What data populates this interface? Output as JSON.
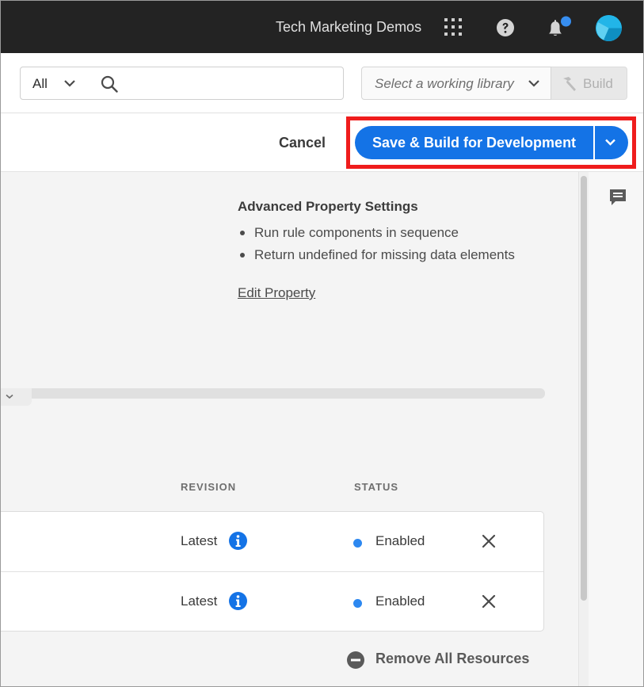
{
  "header": {
    "org_name": "Tech Marketing Demos",
    "icons": [
      "apps-icon",
      "help-icon",
      "bell-icon",
      "avatar"
    ],
    "notification_color": "#378ef0"
  },
  "search": {
    "scope": "All",
    "placeholder": "",
    "value": "",
    "library_placeholder": "Select a working library",
    "build_label": "Build"
  },
  "actions": {
    "cancel_label": "Cancel",
    "save_build_label": "Save & Build for Development",
    "primary_color": "#1473e6",
    "highlight_color": "#ef1c1c"
  },
  "advanced_settings": {
    "title": "Advanced Property Settings",
    "items": [
      "Run rule components in sequence",
      "Return undefined for missing data elements"
    ],
    "edit_link": "Edit Property"
  },
  "resources_table": {
    "columns": {
      "revision": "REVISION",
      "status": "STATUS"
    },
    "rows": [
      {
        "revision": "Latest",
        "status": "Enabled"
      },
      {
        "revision": "Latest",
        "status": "Enabled"
      }
    ],
    "remove_all_label": "Remove All Resources",
    "status_color": "#2d88f0"
  }
}
